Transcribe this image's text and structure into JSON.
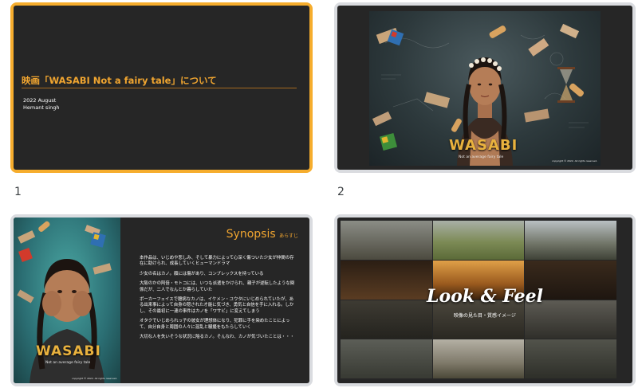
{
  "slides": [
    {
      "number": "1",
      "title": "映画「WASABI Not a fairy tale」について",
      "date": "2022 August",
      "author": "Hemant singh"
    },
    {
      "number": "2",
      "poster_title": "WASABI",
      "poster_tagline": "Not an average fairy tale",
      "copyright": "copyright © 2022. All rights reserved."
    },
    {
      "number": "",
      "heading": "Synopsis",
      "heading_jp": "あらすじ",
      "paragraphs": [
        "本作品は、いじめや悲しみ、そして暴力によって心深く傷ついた少女が仲間の存在に助けられ、成長していくヒューマンドラマ",
        "少女の名はカノ。顔には傷があり、コンプレックスを持っている",
        "大阪のかの阿倍・モトコには、いつも派遣をかけられ、親子が逆転したような関係だが、二人でなんとか暮らしていた",
        "ポーカーフェイスで臆病なカノは、イケメン・ユウタにいじめられていたが、ある出来事によって自身の隠された才能に気づき、勇気と自信を手に入れる。しかし、その最初に一連の事件はカノを「ワサビ」に変えてしまう",
        "オタクでいじめられっ子の彼女が理想体になり、犯罪に手を染めたことによって、自分自身と周囲の人々に混乱と騒擾をもたらしていく",
        "大切な人を失いそうな状況に陥るカノ。そんなわ、カノが気づいたことは・・・"
      ],
      "poster_title": "WASABI",
      "poster_tagline": "Not an average fairy tale",
      "copyright": "copyright © 2022. All rights reserved."
    },
    {
      "number": "",
      "title": "Look & Feel",
      "subtitle": "映像の見た目・質感イメージ"
    }
  ],
  "colors": {
    "accent": "#f0a530",
    "selected_border": "#f6ad2d",
    "slide_bg": "#262626",
    "thumb_border": "#dadce0"
  }
}
